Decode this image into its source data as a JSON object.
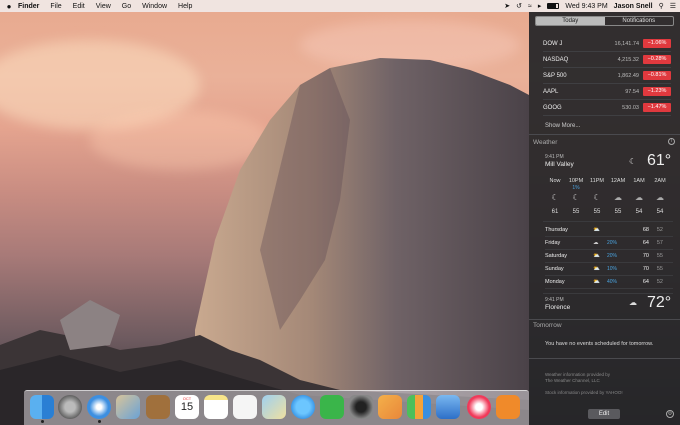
{
  "menubar": {
    "apple": "",
    "items": [
      "Finder",
      "File",
      "Edit",
      "View",
      "Go",
      "Window",
      "Help"
    ],
    "clock": "Wed 9:43 PM",
    "user": "Jason Snell"
  },
  "notification_center": {
    "tabs": [
      "Today",
      "Notifications"
    ],
    "stocks": [
      {
        "symbol": "DOW J",
        "price": "16,141.74",
        "change": "−1.06%"
      },
      {
        "symbol": "NASDAQ",
        "price": "4,215.32",
        "change": "−0.28%"
      },
      {
        "symbol": "S&P 500",
        "price": "1,862.49",
        "change": "−0.81%"
      },
      {
        "symbol": "AAPL",
        "price": "97.54",
        "change": "−1.23%"
      },
      {
        "symbol": "GOOG",
        "price": "530.03",
        "change": "−1.47%"
      }
    ],
    "show_more": "Show More...",
    "weather": {
      "title": "Weather",
      "location1": {
        "time": "9:41 PM",
        "name": "Mill Valley",
        "temp": "61°"
      },
      "hourly": [
        {
          "label": "Now",
          "pct": "",
          "temp": "61"
        },
        {
          "label": "10PM",
          "pct": "1%",
          "temp": "55"
        },
        {
          "label": "11PM",
          "pct": "",
          "temp": "55"
        },
        {
          "label": "12AM",
          "pct": "",
          "temp": "55"
        },
        {
          "label": "1AM",
          "pct": "",
          "temp": "54"
        },
        {
          "label": "2AM",
          "pct": "",
          "temp": "54"
        }
      ],
      "daily": [
        {
          "day": "Thursday",
          "pct": "",
          "hi": "68",
          "lo": "52"
        },
        {
          "day": "Friday",
          "pct": "20%",
          "hi": "64",
          "lo": "57"
        },
        {
          "day": "Saturday",
          "pct": "20%",
          "hi": "70",
          "lo": "55"
        },
        {
          "day": "Sunday",
          "pct": "10%",
          "hi": "70",
          "lo": "55"
        },
        {
          "day": "Monday",
          "pct": "40%",
          "hi": "64",
          "lo": "52"
        }
      ],
      "location2": {
        "time": "9:41 PM",
        "name": "Florence",
        "temp": "72°"
      }
    },
    "tomorrow": {
      "title": "Tomorrow",
      "message": "You have no events scheduled for tomorrow."
    },
    "credits": [
      "Weather information provided by",
      "The Weather Channel, LLC",
      "Stock information provided by YAHOO!"
    ],
    "edit_label": "Edit"
  },
  "calendar_icon": {
    "month": "OCT",
    "day": "15"
  }
}
